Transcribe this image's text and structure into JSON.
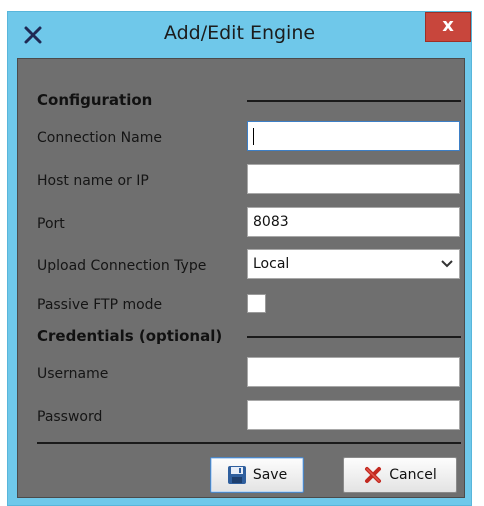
{
  "window": {
    "title": "Add/Edit Engine",
    "close_label": "x"
  },
  "sections": {
    "configuration": "Configuration",
    "credentials": "Credentials (optional)"
  },
  "fields": {
    "connection_name": {
      "label": "Connection Name",
      "value": ""
    },
    "host": {
      "label": "Host name or IP",
      "value": ""
    },
    "port": {
      "label": "Port",
      "value": "8083"
    },
    "upload_type": {
      "label": "Upload Connection Type",
      "value": "Local"
    },
    "passive_ftp": {
      "label": "Passive FTP mode",
      "checked": false
    },
    "username": {
      "label": "Username",
      "value": ""
    },
    "password": {
      "label": "Password",
      "value": ""
    }
  },
  "buttons": {
    "save": "Save",
    "cancel": "Cancel"
  },
  "icons": {
    "app": "app-x-icon",
    "save": "floppy-disk-icon",
    "cancel": "red-x-icon"
  },
  "colors": {
    "titlebar": "#6fc8ea",
    "panel": "#6f6f6f",
    "close": "#c8463c"
  }
}
